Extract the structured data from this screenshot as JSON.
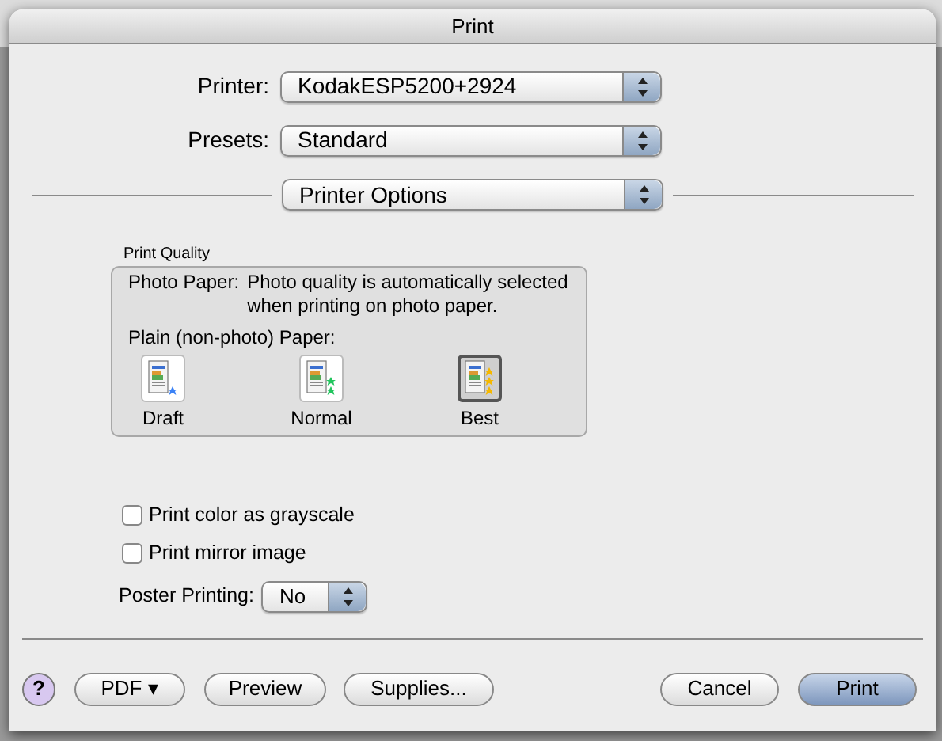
{
  "window": {
    "title": "Print"
  },
  "printer": {
    "label": "Printer:",
    "value": "KodakESP5200+2924"
  },
  "presets": {
    "label": "Presets:",
    "value": "Standard"
  },
  "panel_menu": {
    "value": "Printer Options"
  },
  "print_quality": {
    "title": "Print Quality",
    "photo_label": "Photo Paper:",
    "photo_note": "Photo quality is automatically selected when printing on photo paper.",
    "plain_label": "Plain (non-photo) Paper:",
    "options": [
      {
        "label": "Draft",
        "kind": "draft",
        "selected": false
      },
      {
        "label": "Normal",
        "kind": "normal",
        "selected": false
      },
      {
        "label": "Best",
        "kind": "best",
        "selected": true
      }
    ]
  },
  "checkboxes": [
    {
      "label": "Print color as grayscale",
      "checked": false
    },
    {
      "label": "Print mirror image",
      "checked": false
    }
  ],
  "poster_printing": {
    "label": "Poster Printing:",
    "value": "No"
  },
  "buttons_left": [
    {
      "kind": "help",
      "label": "?"
    },
    {
      "kind": "menu",
      "label": "PDF ▾"
    },
    {
      "kind": "push",
      "label": "Preview"
    },
    {
      "kind": "push",
      "label": "Supplies..."
    }
  ],
  "buttons_right": [
    {
      "label": "Cancel",
      "default": false
    },
    {
      "label": "Print",
      "default": true
    }
  ]
}
